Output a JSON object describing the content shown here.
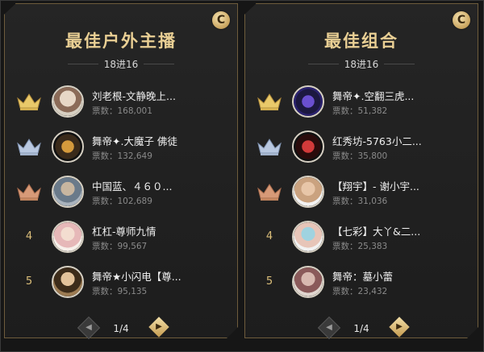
{
  "panels": [
    {
      "title": "最佳户外主播",
      "subtitle": "18进16",
      "corner_badge": "C",
      "page": "1/4",
      "entries": [
        {
          "rank": "",
          "name": "刘老根-文静晚上...",
          "votes": "票数：168,001",
          "crown_color": "#e9c96a"
        },
        {
          "rank": "",
          "name": "舞帝✦.大魔子 佛徒",
          "votes": "票数：132,649",
          "crown_color": "#b9c8e0"
        },
        {
          "rank": "",
          "name": "中国蓝、４６０...",
          "votes": "票数：102,689",
          "crown_color": "#d79a78"
        },
        {
          "rank": "4",
          "name": "杠杠-尊师九情",
          "votes": "票数：99,567",
          "crown_color": ""
        },
        {
          "rank": "5",
          "name": "舞帝★小闪电【尊...",
          "votes": "票数：95,135",
          "crown_color": ""
        }
      ]
    },
    {
      "title": "最佳组合",
      "subtitle": "18进16",
      "corner_badge": "C",
      "page": "1/4",
      "entries": [
        {
          "rank": "",
          "name": "舞帝✦.空翻三虎...",
          "votes": "票数：51,382",
          "crown_color": "#e9c96a"
        },
        {
          "rank": "",
          "name": "红秀坊-5763小二...",
          "votes": "票数：35,800",
          "crown_color": "#b9c8e0"
        },
        {
          "rank": "",
          "name": "【翔宇】- 谢小宇...",
          "votes": "票数：31,036",
          "crown_color": "#d79a78"
        },
        {
          "rank": "4",
          "name": "【七彩】大丫&二...",
          "votes": "票数：25,383",
          "crown_color": ""
        },
        {
          "rank": "5",
          "name": "舞帝：墓小蕾",
          "votes": "票数：23,432",
          "crown_color": ""
        }
      ]
    }
  ],
  "colors": {
    "gold_title": "#e9cf94",
    "gold_crown": "#e9c96a",
    "silver_crown": "#b9c8e0",
    "bronze_crown": "#d79a78",
    "panel_border": "#6e5c3c",
    "background": "#1b1b1b"
  },
  "icons": {
    "corner": "refresh-c-badge-icon",
    "crown": "crown-icon",
    "prev": "chevron-left-icon",
    "next": "chevron-right-icon"
  }
}
